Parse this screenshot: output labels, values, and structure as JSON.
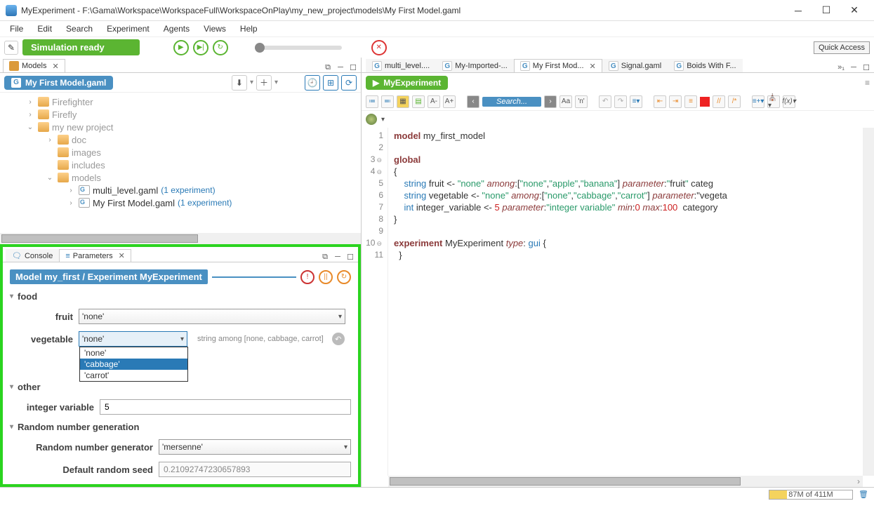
{
  "title": "MyExperiment - F:\\Gama\\Workspace\\WorkspaceFull\\WorkspaceOnPlay\\my_new_project\\models\\My First Model.gaml",
  "menu": [
    "File",
    "Edit",
    "Search",
    "Experiment",
    "Agents",
    "Views",
    "Help"
  ],
  "sim_status": "Simulation ready",
  "quick_access": "Quick Access",
  "models_panel": {
    "tab": "Models",
    "current_file": "My First Model.gaml",
    "tree": {
      "firefighter": "Firefighter",
      "firefly": "Firefly",
      "mynewproject": "my new project",
      "doc": "doc",
      "images": "images",
      "includes": "includes",
      "models": "models",
      "multi": "multi_level.gaml",
      "multi_exp": "(1 experiment)",
      "first": "My First Model.gaml",
      "first_exp": "(1 experiment)"
    }
  },
  "bottom_tabs": {
    "console": "Console",
    "params": "Parameters"
  },
  "params": {
    "title": "Model my_first / Experiment MyExperiment",
    "sections": {
      "food": "food",
      "other": "other",
      "rng": "Random number generation"
    },
    "labels": {
      "fruit": "fruit",
      "vegetable": "vegetable",
      "intvar": "integer variable",
      "rng_gen": "Random number generator",
      "seed": "Default random seed"
    },
    "values": {
      "fruit": "'none'",
      "vegetable": "'none'",
      "vegetable_hint": "string among [none, cabbage, carrot]",
      "veg_options": [
        "'none'",
        "'cabbage'",
        "'carrot'"
      ],
      "intvar": "5",
      "rng_gen": "'mersenne'",
      "seed": "0.21092747230657893"
    }
  },
  "editor_tabs": [
    {
      "label": "multi_level....",
      "icon": "g"
    },
    {
      "label": "My-Imported-...",
      "icon": "g"
    },
    {
      "label": "My First Mod...",
      "icon": "g",
      "active": true
    },
    {
      "label": "Signal.gaml",
      "icon": "g"
    },
    {
      "label": "Boids With F...",
      "icon": "g"
    }
  ],
  "experiment_button": "MyExperiment",
  "search_placeholder": "Search...",
  "code_lines": [
    "model my_first_model",
    "",
    "global",
    "{",
    "    string fruit <- \"none\" among:[\"none\",\"apple\",\"banana\"] parameter:\"fruit\" categ",
    "    string vegetable <- \"none\" among:[\"none\",\"cabbage\",\"carrot\"] parameter:\"vegeta",
    "    int integer_variable <- 5 parameter:\"integer variable\" min:0 max:100  category",
    "}",
    "",
    "experiment MyExperiment type: gui {",
    "  }"
  ],
  "status": {
    "mem": "87M of 411M"
  }
}
